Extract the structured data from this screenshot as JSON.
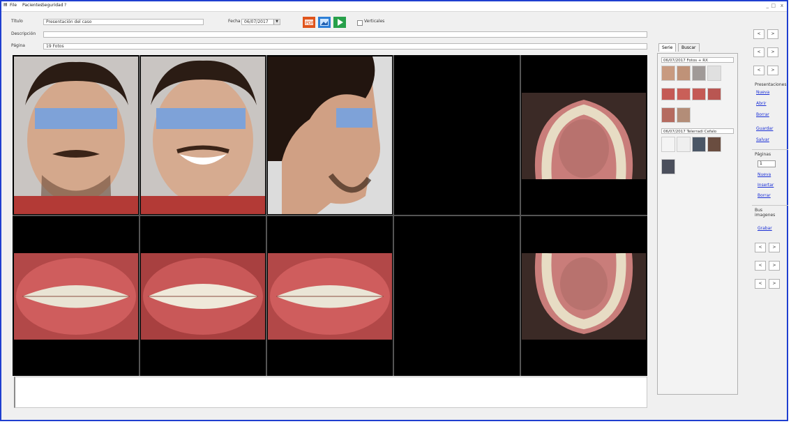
{
  "menu": {
    "icon": "app-icon",
    "items": [
      "File",
      "Pacientes",
      "Seguridad",
      "?"
    ]
  },
  "window_controls": [
    "_",
    "□",
    "x"
  ],
  "form": {
    "titulo_label": "Título",
    "titulo_value": "Presentación del caso",
    "fecha_label": "Fecha",
    "fecha_value": "06/07/2017",
    "descripcion_label": "Descripción",
    "descripcion_value": "",
    "pagina_label": "Página",
    "pagina_value": "19 Fotos",
    "verticales_label": "Verticales"
  },
  "toolbar": {
    "pdf_icon": "pdf-export-icon",
    "image_icon": "image-icon",
    "present_icon": "presentation-play-icon"
  },
  "thumb_tabs": [
    "Serie",
    "Buscar"
  ],
  "groups": [
    "06/07/2017 Fotos + RX",
    "06/07/2017 Telerradi Cefalo"
  ],
  "right_panel": {
    "presentacion_title": "Presentaciones",
    "presentacion_links": [
      "Nueva",
      "Abrir",
      "Borrar",
      "Guardar",
      "Salvar"
    ],
    "paginas_title": "Páginas",
    "page_number": "1",
    "paginas_links": [
      "Nueva",
      "Insertar",
      "Borrar"
    ],
    "imagenes_title": "Bus imagenes",
    "imagenes_links": [
      "Grabar"
    ],
    "nav_buttons": [
      "<",
      ">",
      "<",
      ">",
      "<",
      ">"
    ]
  },
  "colors": {
    "window_border": "#1f3fd0",
    "link": "#1a2fd6",
    "mask": "#7ea2d8",
    "pdf": "#e0541c",
    "image": "#2d7fd6",
    "present": "#27a04a"
  }
}
